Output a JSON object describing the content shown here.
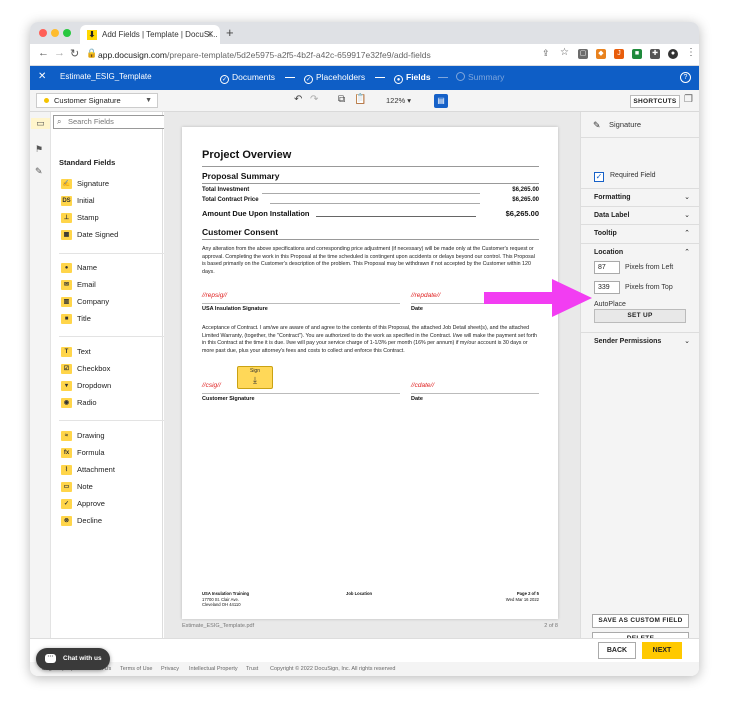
{
  "browser": {
    "tab_title": "Add Fields | Template | DocuSi...",
    "url_host": "app.docusign.com",
    "url_path": "/prepare-template/5d2e5975-a2f5-4b2f-a42c-659917e32fe9/add-fields"
  },
  "header": {
    "template_name": "Estimate_ESIG_Template",
    "steps": [
      {
        "label": "Documents"
      },
      {
        "label": "Placeholders"
      },
      {
        "label": "Fields"
      },
      {
        "label": "Summary"
      }
    ]
  },
  "toolbar": {
    "recipient": "Customer Signature",
    "zoom": "122%",
    "shortcuts": "SHORTCUTS"
  },
  "palette": {
    "search_placeholder": "Search Fields",
    "section": "Standard Fields",
    "groups": [
      [
        "Signature",
        "Initial",
        "Stamp",
        "Date Signed"
      ],
      [
        "Name",
        "Email",
        "Company",
        "Title"
      ],
      [
        "Text",
        "Checkbox",
        "Dropdown",
        "Radio"
      ],
      [
        "Drawing",
        "Formula",
        "Attachment",
        "Note",
        "Approve",
        "Decline"
      ]
    ]
  },
  "document": {
    "title": "Project Overview",
    "summary_heading": "Proposal Summary",
    "rows": [
      {
        "label": "Total Investment",
        "amount": "$6,265.00"
      },
      {
        "label": "Total Contract Price",
        "amount": "$6,265.00"
      }
    ],
    "due_label": "Amount Due Upon Installation",
    "due_amount": "$6,265.00",
    "consent_heading": "Customer Consent",
    "consent_text": "Any alteration from the above specifications and corresponding price adjustment (if necessary) will be made only at the Customer's request or approval. Completing the work in this Proposal at the time scheduled is contingent upon accidents or delays beyond our control. This Proposal is based primarily on the Customer's description of the problem. This Proposal may be withdrawn if not accepted by the Customer within 120 days.",
    "tag_repsig": "//repsig//",
    "tag_repdate": "//repdate//",
    "label_rep_sig": "USA Insulation Signature",
    "label_date": "Date",
    "acceptance_text": "Acceptance of Contract. I am/we are aware of and agree to the contents of this Proposal, the attached Job Detail sheet(s), and the attached Limited Warranty, (together, the \"Contract\"). You are authorized to do the work as specified in the Contract. I/we will make the payment set forth in this Contract at the time it is due. I/we will pay your service charge of 1-1/3% per month (16% per annum) if my/our account is 30 days or more past due, plus your attorney's fees and costs to collect and enforce this Contract.",
    "tag_csig": "//csig//",
    "tag_cdate": "//cdate//",
    "label_cust_sig": "Customer Signature",
    "sign_tag": "Sign",
    "footer_company": "USA Insulation Training",
    "footer_addr1": "17700 St. Clair Ave.",
    "footer_addr2": "Cleveland OH 44110",
    "footer_job": "Job Location",
    "footer_page": "Page 2 of 5",
    "footer_date": "Wed Mar 16 2022",
    "doc_name": "Estimate_ESIG_Template.pdf",
    "page_count": "2 of 8"
  },
  "props": {
    "field_type": "Signature",
    "required_label": "Required Field",
    "sections": {
      "formatting": "Formatting",
      "data_label": "Data Label",
      "tooltip": "Tooltip",
      "location": "Location",
      "sender_permissions": "Sender Permissions"
    },
    "pixels_left": "87",
    "pixels_left_label": "Pixels from Left",
    "pixels_top": "339",
    "pixels_top_label": "Pixels from Top",
    "autoplace": "AutoPlace",
    "setup": "SET UP",
    "save_custom": "SAVE AS CUSTOM FIELD",
    "delete": "DELETE"
  },
  "footer": {
    "back": "BACK",
    "next": "NEXT",
    "chat": "Chat with us",
    "links": [
      "English (US)",
      "Contact Us",
      "Terms of Use",
      "Privacy",
      "Intellectual Property",
      "Trust"
    ],
    "copyright": "Copyright © 2022 DocuSign, Inc. All rights reserved"
  },
  "colors": {
    "brand_blue": "#0e5ec6",
    "field_yellow": "#ffd54a",
    "next_yellow": "#ffc900",
    "arrow_magenta": "#f23df2",
    "tag_red": "#e02020"
  }
}
